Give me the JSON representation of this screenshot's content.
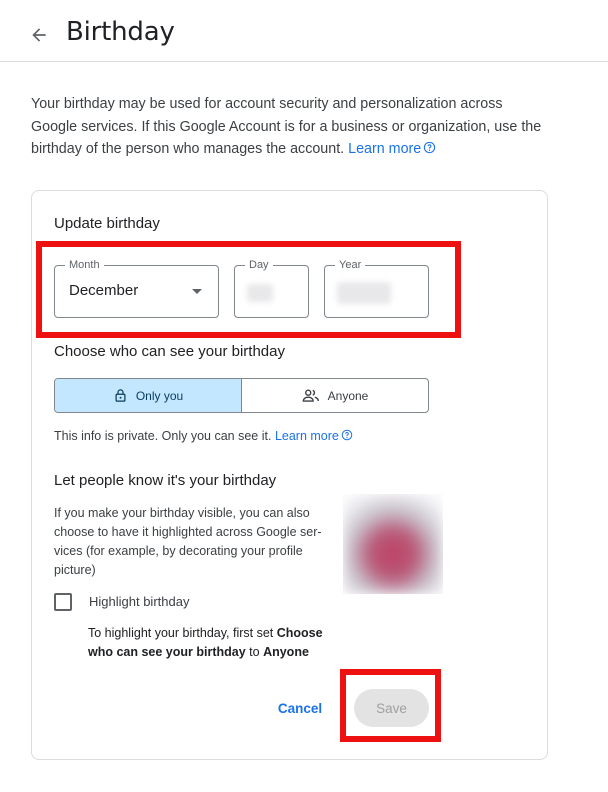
{
  "header": {
    "title": "Birthday",
    "back_icon": "arrow-back-icon"
  },
  "intro": {
    "text": "Your birthday may be used for account security and personalization across Google services. If this Google Account is for a business or organization, use the birthday of the person who manages the account.",
    "link": "Learn more"
  },
  "update": {
    "title": "Update birthday",
    "month": {
      "label": "Month",
      "value": "December"
    },
    "day": {
      "label": "Day"
    },
    "year": {
      "label": "Year"
    }
  },
  "visibility": {
    "title": "Choose who can see your birthday",
    "options": [
      {
        "label": "Only you",
        "icon": "lock-icon",
        "selected": true
      },
      {
        "label": "Anyone",
        "icon": "people-icon",
        "selected": false
      }
    ],
    "info": "This info is private. Only you can see it.",
    "info_link": "Learn more"
  },
  "highlight": {
    "title": "Let people know it's your birthday",
    "description_lines": [
      "If you make your birthday visible, you can also",
      "choose to have it highlighted across Google ser-",
      "vices (for example, by decorating your profile",
      "picture)"
    ],
    "checkbox_label": "Highlight birthday",
    "checked": false,
    "note_prefix": "To highlight your birthday, first set ",
    "note_bold1": "Choose",
    "note_bold2": "who can see your birthday",
    "note_mid": " to ",
    "note_bold3": "Anyone"
  },
  "actions": {
    "cancel": "Cancel",
    "save": "Save"
  },
  "colors": {
    "accent": "#1a73e8",
    "selected_bg": "#c2e7ff",
    "annotation": "#ee1111"
  }
}
